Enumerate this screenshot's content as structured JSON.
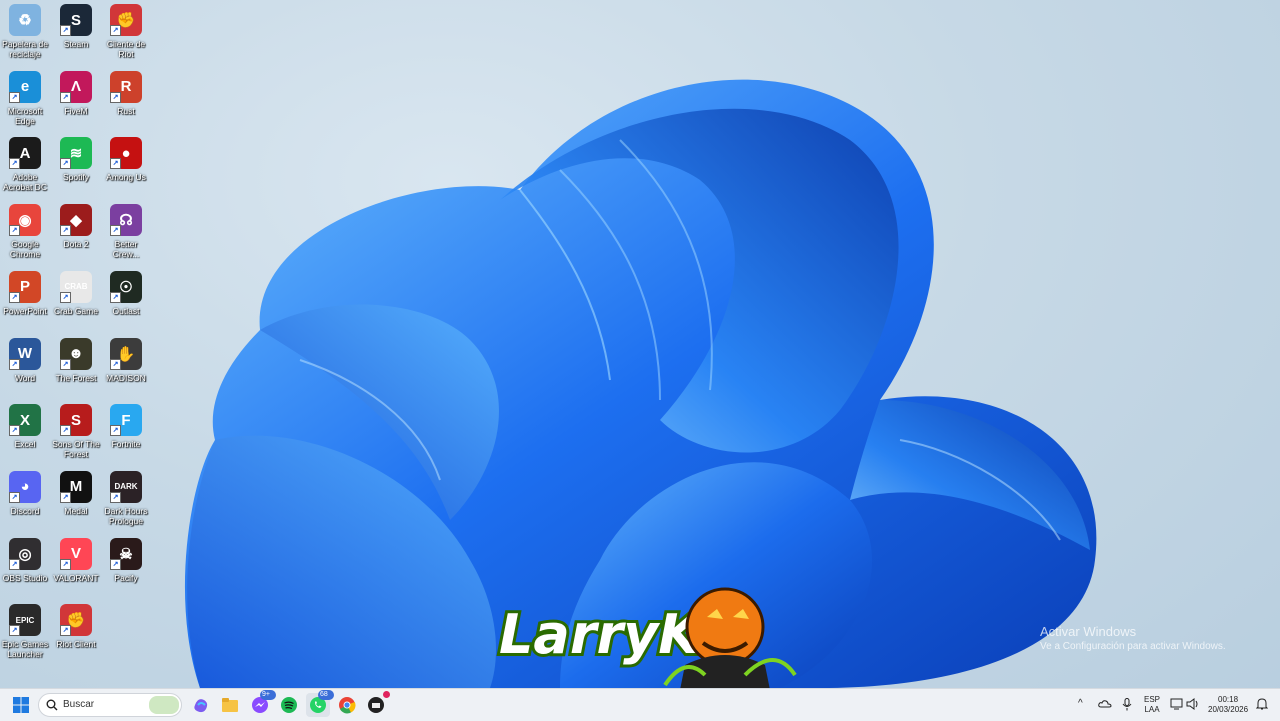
{
  "desktop": {
    "icons_col1": [
      {
        "label": "Papelera de reciclaje",
        "icon": "recycle-bin-icon",
        "color": "#7fb3e0",
        "glyph": "♻"
      },
      {
        "label": "Microsoft Edge",
        "icon": "edge-icon",
        "color": "#1a8fd8",
        "glyph": "e"
      },
      {
        "label": "Adobe Acrobat DC",
        "icon": "acrobat-icon",
        "color": "#1b1b1b",
        "glyph": "A"
      },
      {
        "label": "Google Chrome",
        "icon": "chrome-icon",
        "color": "#e8453c",
        "glyph": "◉"
      },
      {
        "label": "PowerPoint",
        "icon": "powerpoint-icon",
        "color": "#d24726",
        "glyph": "P"
      },
      {
        "label": "Word",
        "icon": "word-icon",
        "color": "#2b579a",
        "glyph": "W"
      },
      {
        "label": "Excel",
        "icon": "excel-icon",
        "color": "#217346",
        "glyph": "X"
      },
      {
        "label": "Discord",
        "icon": "discord-icon",
        "color": "#5865f2",
        "glyph": "◕"
      },
      {
        "label": "OBS Studio",
        "icon": "obs-icon",
        "color": "#302e31",
        "glyph": "◎"
      },
      {
        "label": "Epic Games Launcher",
        "icon": "epic-games-icon",
        "color": "#2a2a2a",
        "glyph": "EPIC"
      }
    ],
    "icons_col2": [
      {
        "label": "Steam",
        "icon": "steam-icon",
        "color": "#1b2838",
        "glyph": "S"
      },
      {
        "label": "FiveM",
        "icon": "fivem-icon",
        "color": "#c2185b",
        "glyph": "Λ"
      },
      {
        "label": "Spotify",
        "icon": "spotify-icon",
        "color": "#1db954",
        "glyph": "≋"
      },
      {
        "label": "Dota 2",
        "icon": "dota-icon",
        "color": "#9c1c1c",
        "glyph": "◆"
      },
      {
        "label": "Crab Game",
        "icon": "crab-game-icon",
        "color": "#e8e8e8",
        "glyph": "CRAB"
      },
      {
        "label": "The Forest",
        "icon": "the-forest-icon",
        "color": "#3a3a2a",
        "glyph": "☻"
      },
      {
        "label": "Sons Of The Forest",
        "icon": "sons-of-the-forest-icon",
        "color": "#b71c1c",
        "glyph": "S"
      },
      {
        "label": "Medal",
        "icon": "medal-icon",
        "color": "#111111",
        "glyph": "M"
      },
      {
        "label": "VALORANT",
        "icon": "valorant-icon",
        "color": "#ff4655",
        "glyph": "V"
      },
      {
        "label": "Riot Client",
        "icon": "riot-client-icon",
        "color": "#d13639",
        "glyph": "✊"
      }
    ],
    "icons_col3": [
      {
        "label": "Cliente de Riot",
        "icon": "riot-client-icon",
        "color": "#d13639",
        "glyph": "✊"
      },
      {
        "label": "Rust",
        "icon": "rust-icon",
        "color": "#cd412b",
        "glyph": "R"
      },
      {
        "label": "Among Us",
        "icon": "among-us-icon",
        "color": "#c51111",
        "glyph": "●"
      },
      {
        "label": "Better Crew...",
        "icon": "better-crewlink-icon",
        "color": "#7b3fa0",
        "glyph": "☊"
      },
      {
        "label": "Outlast",
        "icon": "outlast-icon",
        "color": "#1f2a22",
        "glyph": "☉"
      },
      {
        "label": "MADISON",
        "icon": "madison-icon",
        "color": "#3c3c3c",
        "glyph": "✋"
      },
      {
        "label": "Fortnite",
        "icon": "fortnite-icon",
        "color": "#29a8f0",
        "glyph": "F"
      },
      {
        "label": "Dark Hours Prologue",
        "icon": "dark-hours-icon",
        "color": "#2b2226",
        "glyph": "DARK"
      },
      {
        "label": "Pacify",
        "icon": "pacify-icon",
        "color": "#2a1a1a",
        "glyph": "☠"
      }
    ]
  },
  "watermark": {
    "line1": "Activar Windows",
    "line2": "Ve a Configuración para activar Windows."
  },
  "logo": {
    "text": "LarryK1"
  },
  "taskbar": {
    "search_placeholder": "Buscar",
    "apps": [
      {
        "icon": "start-icon"
      },
      {
        "icon": "widgets-icon"
      },
      {
        "icon": "copilot-icon"
      },
      {
        "icon": "file-explorer-icon"
      },
      {
        "icon": "messenger-icon",
        "badge": "9+"
      },
      {
        "icon": "spotify-icon"
      },
      {
        "icon": "whatsapp-icon",
        "badge": "68"
      },
      {
        "icon": "chrome-icon"
      },
      {
        "icon": "riot-client-icon"
      }
    ],
    "tray": {
      "lang_top": "ESP",
      "lang_bottom": "LAA",
      "time": "00:18",
      "date": "20/03/2026"
    }
  }
}
